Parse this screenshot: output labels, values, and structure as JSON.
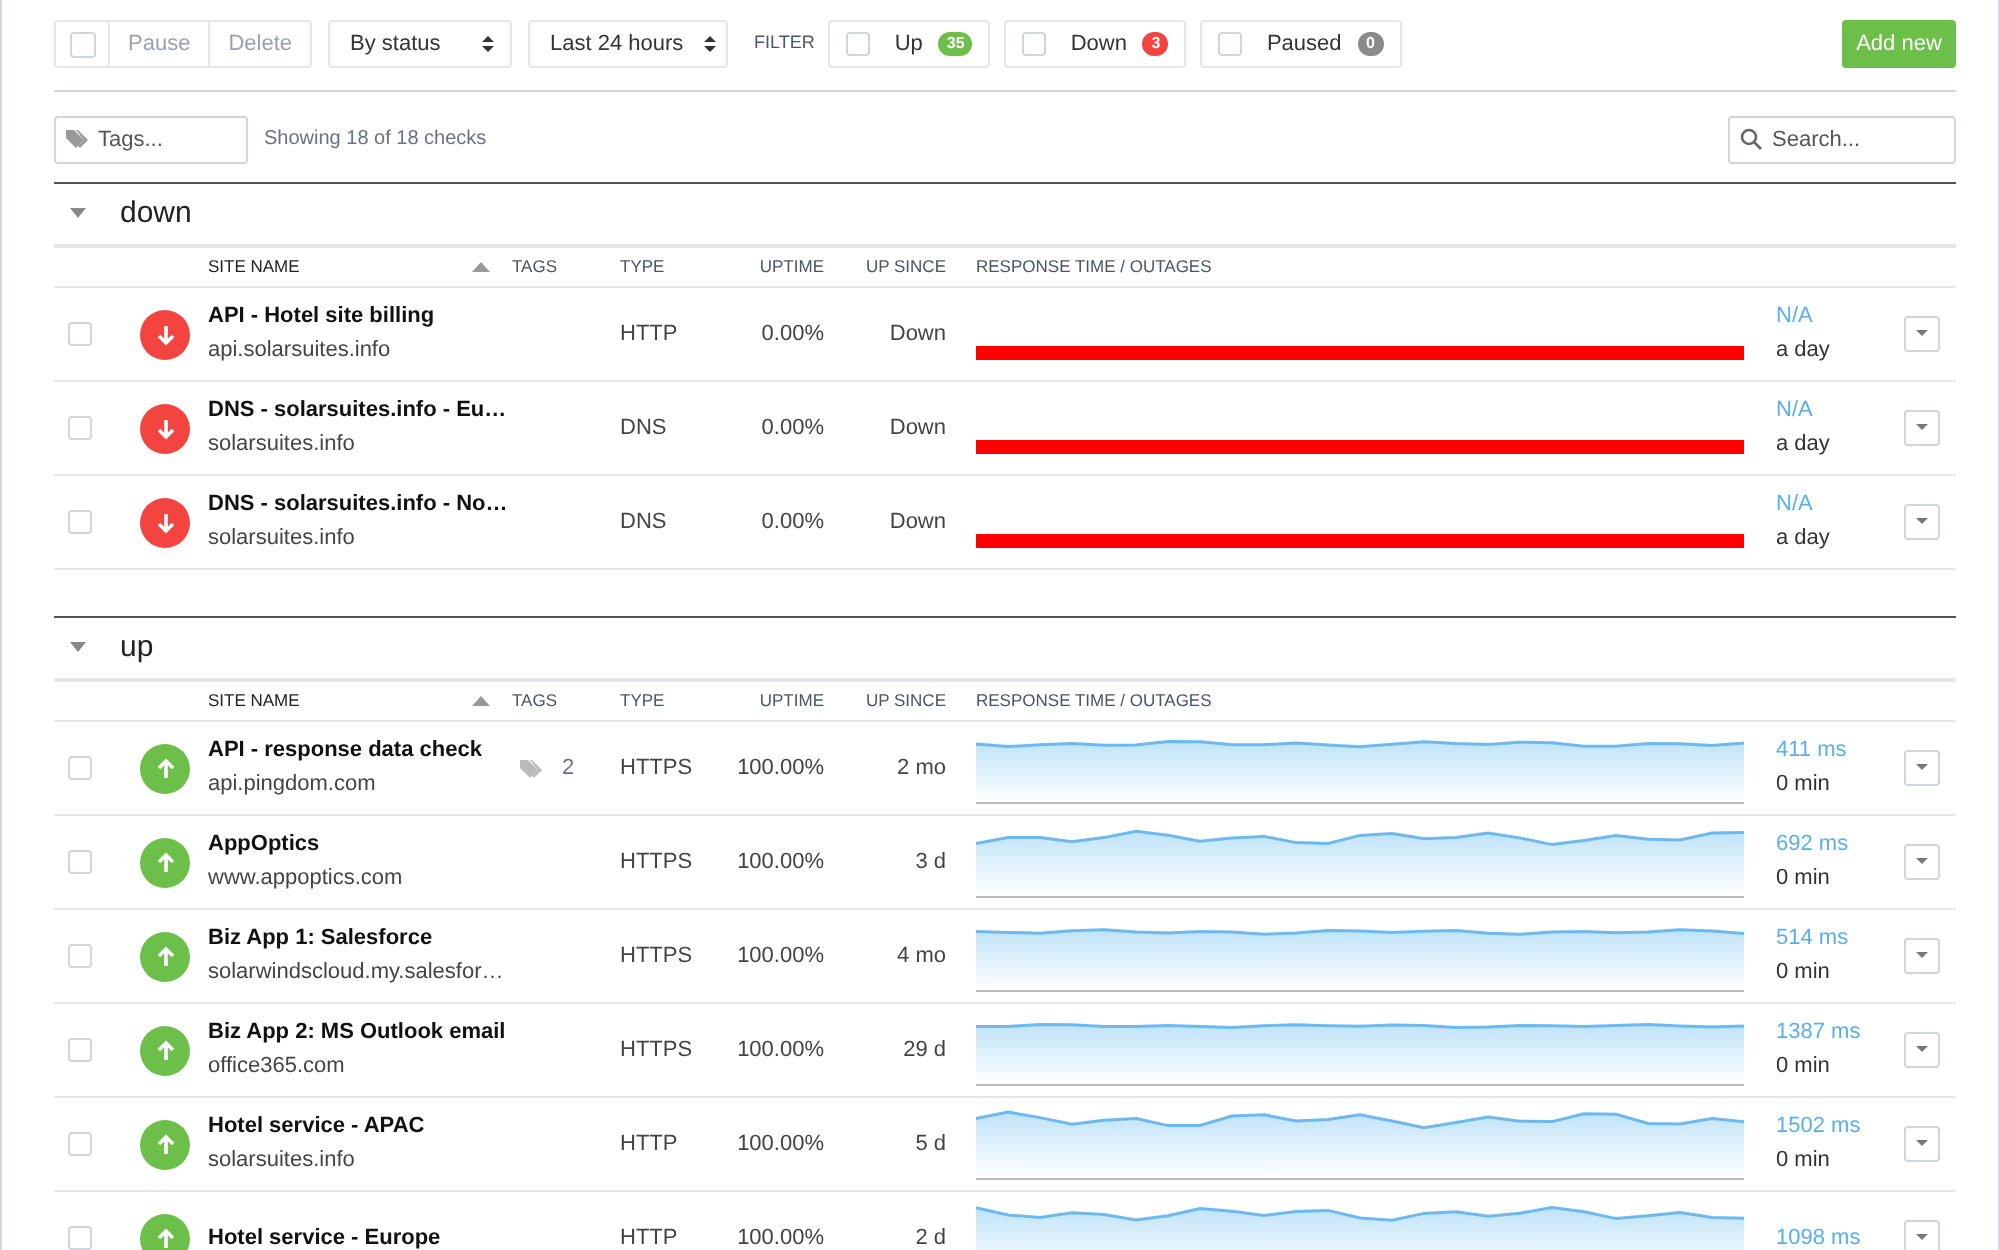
{
  "toolbar": {
    "select_all": {
      "checked": false
    },
    "actions": [
      {
        "label": "Pause",
        "disabled": true
      },
      {
        "label": "Delete",
        "disabled": true
      }
    ],
    "dropdowns": [
      "By status",
      "Last 24 hours"
    ],
    "filter_label": "FILTER",
    "filters": [
      {
        "label": "Up",
        "count": "35",
        "checked": false,
        "color": "#6cc04a"
      },
      {
        "label": "Down",
        "count": "3",
        "checked": false,
        "color": "#f4443f"
      },
      {
        "label": "Paused",
        "count": "0",
        "checked": false,
        "color": "#8a8a8a"
      }
    ],
    "add_button": "Add new"
  },
  "tags_field": {
    "placeholder": "Tags..."
  },
  "summary": "Showing 18 of 18 checks",
  "search": {
    "placeholder": "Search..."
  },
  "groups": [
    {
      "title": "down",
      "expanded": true,
      "columns": [
        "SITE NAME",
        "TAGS",
        "TYPE",
        "UPTIME",
        "UP SINCE",
        "RESPONSE TIME / OUTAGES"
      ],
      "rows": [
        {
          "checked": false,
          "kind": "down",
          "name": "API - Hotel site billing",
          "url": "api.solarsuites.info",
          "type": "HTTP",
          "uptime": "0.00%",
          "up_since": "Down",
          "response": "N/A",
          "outage": "a day"
        },
        {
          "checked": false,
          "kind": "down",
          "name": "DNS - solarsuites.info - Eu…",
          "url": "solarsuites.info",
          "type": "DNS",
          "uptime": "0.00%",
          "up_since": "Down",
          "response": "N/A",
          "outage": "a day"
        },
        {
          "checked": false,
          "kind": "down",
          "name": "DNS - solarsuites.info - No…",
          "url": "solarsuites.info",
          "type": "DNS",
          "uptime": "0.00%",
          "up_since": "Down",
          "response": "N/A",
          "outage": "a day"
        }
      ]
    },
    {
      "title": "up",
      "expanded": true,
      "columns": [
        "SITE NAME",
        "TAGS",
        "TYPE",
        "UPTIME",
        "UP SINCE",
        "RESPONSE TIME / OUTAGES"
      ],
      "rows": [
        {
          "checked": false,
          "kind": "up",
          "name": "API - response data check",
          "url": "api.pingdom.com",
          "tags": "2",
          "type": "HTTPS",
          "uptime": "100.00%",
          "up_since": "2 mo",
          "response": "411 ms",
          "outage": "0 min"
        },
        {
          "checked": false,
          "kind": "up",
          "name": "AppOptics",
          "url": "www.appoptics.com",
          "type": "HTTPS",
          "uptime": "100.00%",
          "up_since": "3 d",
          "response": "692 ms",
          "outage": "0 min"
        },
        {
          "checked": false,
          "kind": "up",
          "name": "Biz App 1: Salesforce",
          "url": "solarwindscloud.my.salesfor…",
          "type": "HTTPS",
          "uptime": "100.00%",
          "up_since": "4 mo",
          "response": "514 ms",
          "outage": "0 min"
        },
        {
          "checked": false,
          "kind": "up",
          "name": "Biz App 2: MS Outlook email",
          "url": "office365.com",
          "type": "HTTPS",
          "uptime": "100.00%",
          "up_since": "29 d",
          "response": "1387 ms",
          "outage": "0 min"
        },
        {
          "checked": false,
          "kind": "up",
          "name": "Hotel service - APAC",
          "url": "solarsuites.info",
          "type": "HTTP",
          "uptime": "100.00%",
          "up_since": "5 d",
          "response": "1502 ms",
          "outage": "0 min"
        },
        {
          "checked": false,
          "kind": "up",
          "name": "Hotel service - Europe",
          "type": "HTTP",
          "uptime": "100.00%",
          "up_since": "2 d",
          "response": "1098 ms"
        }
      ]
    }
  ]
}
